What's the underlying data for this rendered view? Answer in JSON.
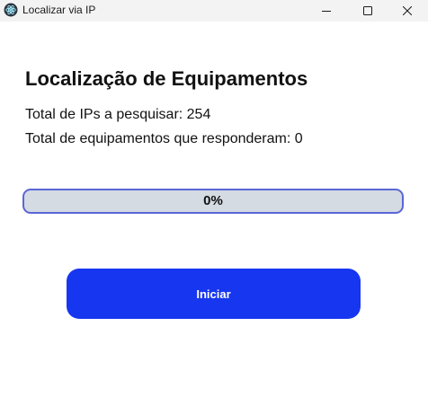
{
  "window": {
    "title": "Localizar via IP",
    "icon": "electron-atom-icon",
    "controls": [
      "minimize",
      "maximize",
      "close"
    ]
  },
  "main": {
    "heading": "Localização de Equipamentos",
    "total_ips_text": "Total de IPs a pesquisar: 254",
    "total_responded_text": "Total de equipamentos que responderam: 0"
  },
  "progress": {
    "value": 0,
    "label": "0%"
  },
  "actions": {
    "start_label": "Iniciar"
  },
  "colors": {
    "accent": "#1736f0",
    "progress_border": "#5b66d6",
    "progress_track": "#d4dbe3",
    "titlebar": "#f3f3f3"
  }
}
